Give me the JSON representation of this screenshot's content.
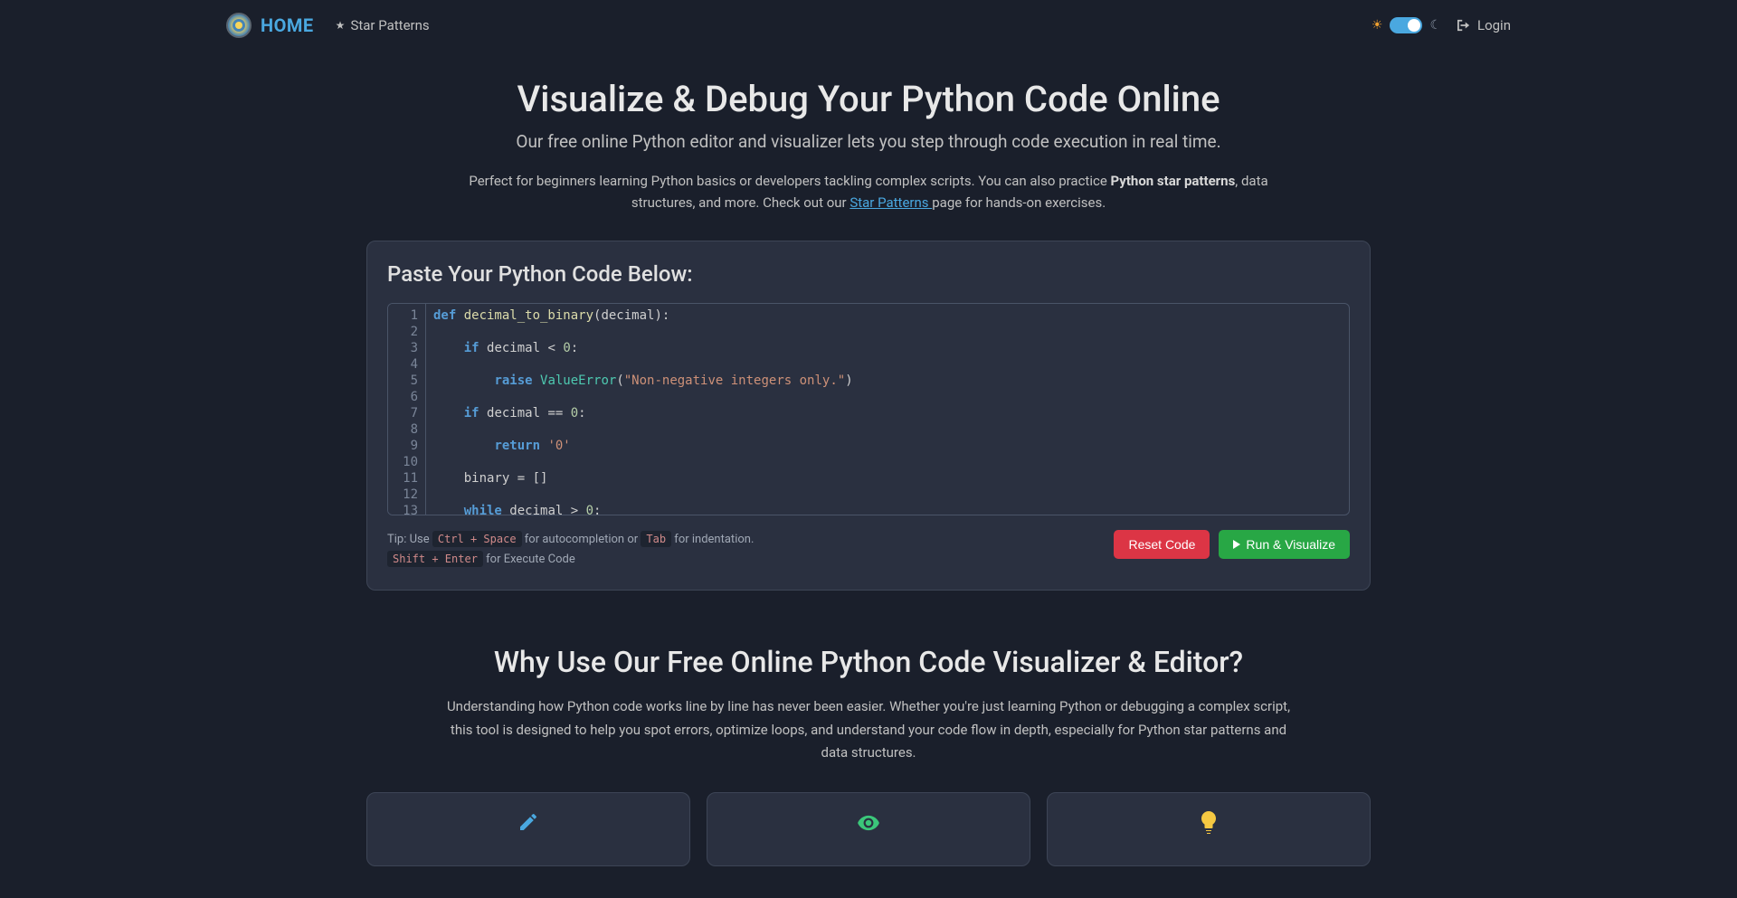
{
  "header": {
    "home": "HOME",
    "star_patterns": "Star Patterns",
    "login": "Login"
  },
  "hero": {
    "title": "Visualize & Debug Your Python Code Online",
    "subtitle": "Our free online Python editor and visualizer lets you step through code execution in real time.",
    "intro_prefix": "Perfect for beginners learning Python basics or developers tackling complex scripts. You can also practice ",
    "intro_strong": "Python star patterns",
    "intro_mid": ", data structures, and more. Check out our ",
    "intro_link": "Star Patterns ",
    "intro_suffix": "page for hands-on exercises."
  },
  "editor": {
    "label": "Paste Your Python Code Below:",
    "line_count": 13,
    "code_lines": [
      {
        "indent": 0,
        "tokens": [
          {
            "t": "def ",
            "c": "kw"
          },
          {
            "t": "decimal_to_binary",
            "c": "fn"
          },
          {
            "t": "(decimal):",
            "c": "op"
          }
        ]
      },
      {
        "indent": 0,
        "tokens": []
      },
      {
        "indent": 1,
        "tokens": [
          {
            "t": "if ",
            "c": "kw"
          },
          {
            "t": "decimal < ",
            "c": "op"
          },
          {
            "t": "0",
            "c": "num"
          },
          {
            "t": ":",
            "c": "op"
          }
        ]
      },
      {
        "indent": 0,
        "tokens": []
      },
      {
        "indent": 2,
        "tokens": [
          {
            "t": "raise ",
            "c": "kw"
          },
          {
            "t": "ValueError",
            "c": "builtin"
          },
          {
            "t": "(",
            "c": "op"
          },
          {
            "t": "\"Non-negative integers only.\"",
            "c": "str"
          },
          {
            "t": ")",
            "c": "op"
          }
        ]
      },
      {
        "indent": 0,
        "tokens": []
      },
      {
        "indent": 1,
        "tokens": [
          {
            "t": "if ",
            "c": "kw"
          },
          {
            "t": "decimal == ",
            "c": "op"
          },
          {
            "t": "0",
            "c": "num"
          },
          {
            "t": ":",
            "c": "op"
          }
        ]
      },
      {
        "indent": 0,
        "tokens": []
      },
      {
        "indent": 2,
        "tokens": [
          {
            "t": "return ",
            "c": "kw"
          },
          {
            "t": "'0'",
            "c": "str"
          }
        ]
      },
      {
        "indent": 0,
        "tokens": []
      },
      {
        "indent": 1,
        "tokens": [
          {
            "t": "binary = []",
            "c": "op"
          }
        ]
      },
      {
        "indent": 0,
        "tokens": []
      },
      {
        "indent": 1,
        "tokens": [
          {
            "t": "while ",
            "c": "kw"
          },
          {
            "t": "decimal > ",
            "c": "op"
          },
          {
            "t": "0",
            "c": "num"
          },
          {
            "t": ":",
            "c": "op"
          }
        ]
      }
    ],
    "tips": {
      "line1_prefix": "Tip: Use ",
      "kbd1": "Ctrl + Space",
      "line1_mid": " for autocompletion or ",
      "kbd2": "Tab",
      "line1_suffix": " for indentation.",
      "kbd3": "Shift + Enter",
      "line2_suffix": " for Execute Code"
    },
    "buttons": {
      "reset": "Reset Code",
      "run": "Run & Visualize"
    }
  },
  "why": {
    "title": "Why Use Our Free Online Python Code Visualizer & Editor?",
    "text": "Understanding how Python code works line by line has never been easier. Whether you're just learning Python or debugging a complex script, this tool is designed to help you spot errors, optimize loops, and understand your code flow in depth, especially for Python star patterns and data structures."
  }
}
